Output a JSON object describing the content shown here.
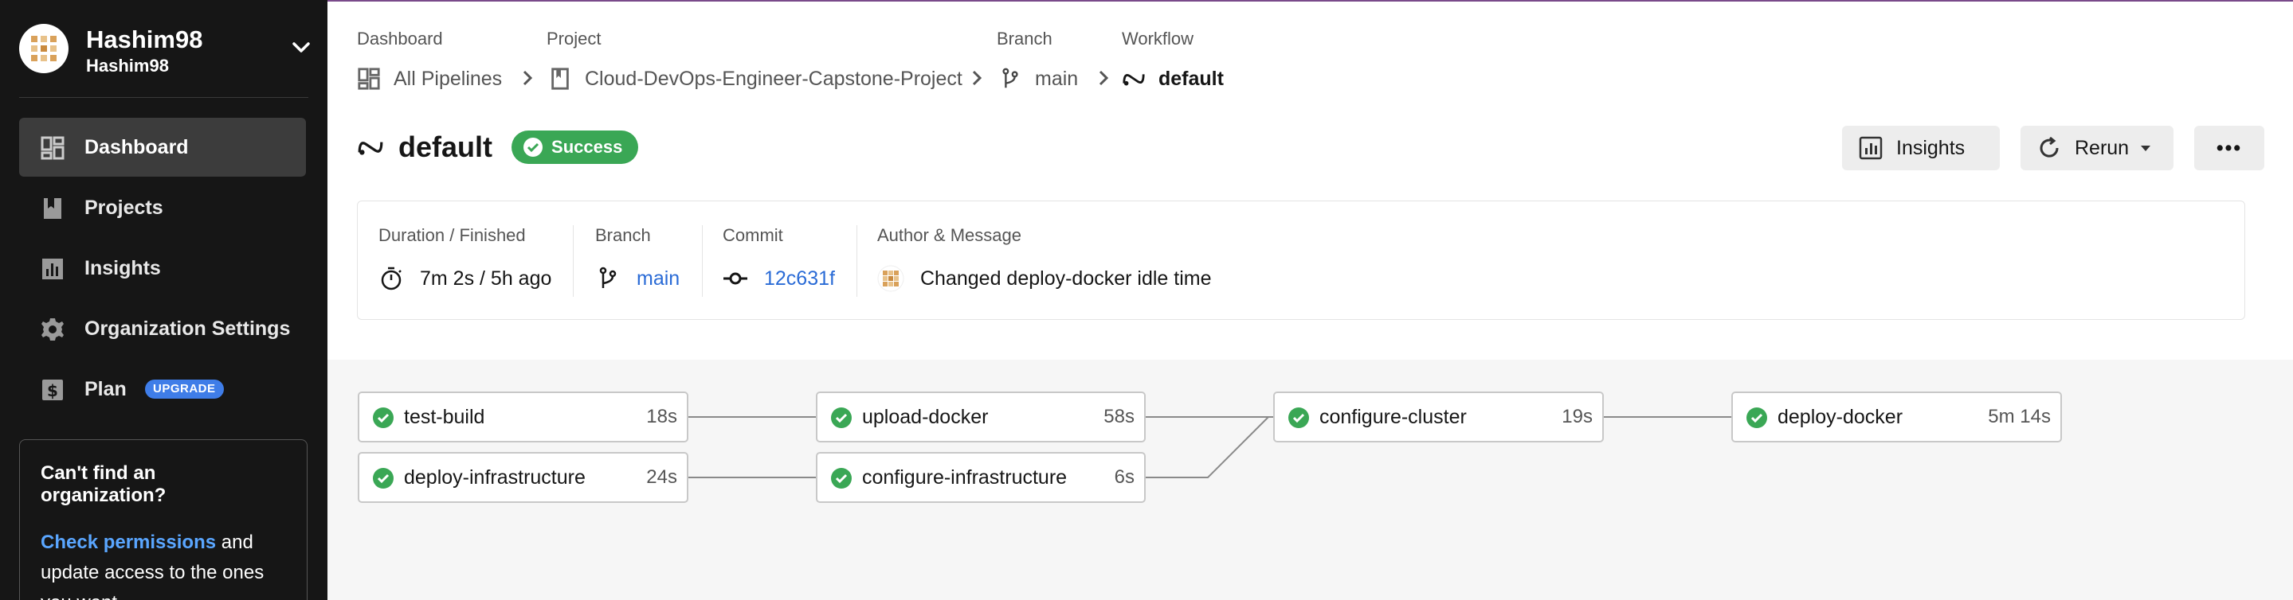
{
  "org": {
    "name": "Hashim98",
    "subname": "Hashim98"
  },
  "nav": {
    "items": [
      {
        "label": "Dashboard"
      },
      {
        "label": "Projects"
      },
      {
        "label": "Insights"
      },
      {
        "label": "Organization Settings"
      },
      {
        "label": "Plan",
        "badge": "UPGRADE"
      }
    ]
  },
  "help_box": {
    "title": "Can't find an organization?",
    "link": "Check permissions",
    "text_after_link": " and update access to the ones you want."
  },
  "breadcrumb": {
    "dashboard": {
      "label": "Dashboard",
      "value": "All Pipelines"
    },
    "project": {
      "label": "Project",
      "value": "Cloud-DevOps-Engineer-Capstone-Project"
    },
    "branch": {
      "label": "Branch",
      "value": "main"
    },
    "workflow": {
      "label": "Workflow",
      "value": "default"
    }
  },
  "workflow": {
    "title": "default",
    "status": "Success",
    "status_color": "#3aa755"
  },
  "actions": {
    "insights": "Insights",
    "rerun": "Rerun",
    "more": "•••"
  },
  "info": {
    "duration": {
      "label": "Duration / Finished",
      "value": "7m 2s / 5h ago"
    },
    "branch": {
      "label": "Branch",
      "value": "main"
    },
    "commit": {
      "label": "Commit",
      "value": "12c631f"
    },
    "author": {
      "label": "Author & Message",
      "message": "Changed deploy-docker idle time"
    }
  },
  "jobs": [
    {
      "name": "test-build",
      "duration": "18s",
      "status": "success"
    },
    {
      "name": "deploy-infrastructure",
      "duration": "24s",
      "status": "success"
    },
    {
      "name": "upload-docker",
      "duration": "58s",
      "status": "success"
    },
    {
      "name": "configure-infrastructure",
      "duration": "6s",
      "status": "success"
    },
    {
      "name": "configure-cluster",
      "duration": "19s",
      "status": "success"
    },
    {
      "name": "deploy-docker",
      "duration": "5m 14s",
      "status": "success"
    }
  ],
  "colors": {
    "accent": "#2a6bd6",
    "success": "#3aa755",
    "sidebar": "#161616"
  }
}
